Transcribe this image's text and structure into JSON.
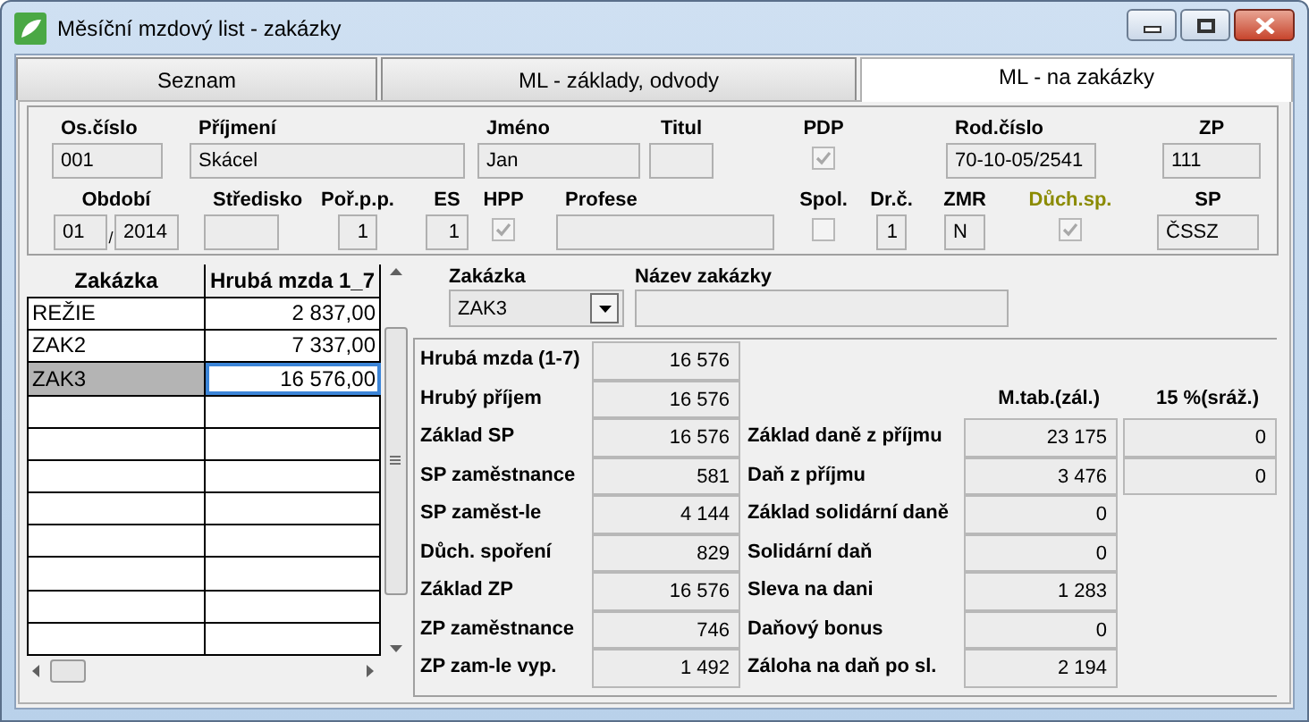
{
  "window": {
    "title": "Měsíční mzdový list - zakázky"
  },
  "tabs": [
    {
      "label": "Seznam",
      "selected": false
    },
    {
      "label": "ML - základy, odvody",
      "selected": false
    },
    {
      "label": "ML - na zakázky",
      "selected": true
    }
  ],
  "header_rows": [
    [
      {
        "kind": "text",
        "label": "Os.číslo",
        "value": "001"
      },
      {
        "kind": "text",
        "label": "Příjmení",
        "value": "Skácel"
      },
      {
        "kind": "text",
        "label": "Jméno",
        "value": "Jan"
      },
      {
        "kind": "text",
        "label": "Titul"
      },
      {
        "kind": "checkbox",
        "label": "PDP",
        "checked": true,
        "disabled": true,
        "accent": false
      },
      {
        "kind": "text",
        "label": "Rod.číslo",
        "value": "70-10-05/2541"
      },
      {
        "kind": "text",
        "label": "ZP",
        "value": "111"
      }
    ],
    [
      {
        "kind": "period",
        "label": "Období",
        "month": "01",
        "separator": "/",
        "year": "2014"
      },
      {
        "kind": "text",
        "label": "Středisko"
      },
      {
        "kind": "text",
        "label": "Poř.p.p.",
        "value": "1"
      },
      {
        "kind": "text",
        "label": "ES",
        "value": "1"
      },
      {
        "kind": "checkbox",
        "label": "HPP",
        "checked": true,
        "disabled": true,
        "accent": false
      },
      {
        "kind": "text",
        "label": "Profese"
      },
      {
        "kind": "checkbox",
        "label": "Spol.",
        "checked": false,
        "disabled": true,
        "accent": false
      },
      {
        "kind": "text",
        "label": "Dr.č.",
        "value": "1"
      },
      {
        "kind": "text",
        "label": "ZMR",
        "value": "N"
      },
      {
        "kind": "checkbox",
        "label": "Důch.sp.",
        "checked": true,
        "disabled": true,
        "accent": true
      },
      {
        "kind": "text",
        "label": "SP",
        "value": "ČSSZ"
      }
    ]
  ],
  "job_grid": {
    "columns": [
      "Zakázka",
      "Hrubá mzda 1_7"
    ],
    "rows": [
      {
        "job": "REŽIE",
        "gross": "2 837,00",
        "selected": false
      },
      {
        "job": "ZAK2",
        "gross": "7 337,00",
        "selected": false
      },
      {
        "job": "ZAK3",
        "gross": "16 576,00",
        "selected": true
      }
    ]
  },
  "job_select": {
    "label": "Zakázka",
    "value": "ZAK3"
  },
  "job_name": {
    "label": "Název zakázky"
  },
  "wage_items": [
    {
      "label": "Hrubá mzda (1-7)",
      "value": "16 576"
    },
    {
      "label": "Hrubý příjem",
      "value": "16 576"
    },
    {
      "label": "Základ SP",
      "value": "16 576"
    },
    {
      "label": "SP zaměstnance",
      "value": "581"
    },
    {
      "label": "SP zaměst-le",
      "value": "4 144"
    },
    {
      "label": "Důch. spoření",
      "value": "829"
    },
    {
      "label": "Základ ZP",
      "value": "16 576"
    },
    {
      "label": "ZP zaměstnance",
      "value": "746"
    },
    {
      "label": "ZP zam-le vyp.",
      "value": "1 492"
    }
  ],
  "tax_columns": [
    "M.tab.(zál.)",
    "15 %(sráž.)"
  ],
  "tax_items": [
    {
      "label": "Základ daně z příjmu",
      "values": [
        "23 175",
        "0"
      ]
    },
    {
      "label": "Daň z příjmu",
      "values": [
        "3 476",
        "0"
      ]
    },
    {
      "label": "Základ solidární daně",
      "values": [
        "0"
      ]
    },
    {
      "label": "Solidární daň",
      "values": [
        "0"
      ]
    },
    {
      "label": "Sleva na dani",
      "values": [
        "1 283"
      ]
    },
    {
      "label": "Daňový bonus",
      "values": [
        "0"
      ]
    },
    {
      "label": "Záloha na daň po sl.",
      "values": [
        "2 194"
      ]
    }
  ]
}
